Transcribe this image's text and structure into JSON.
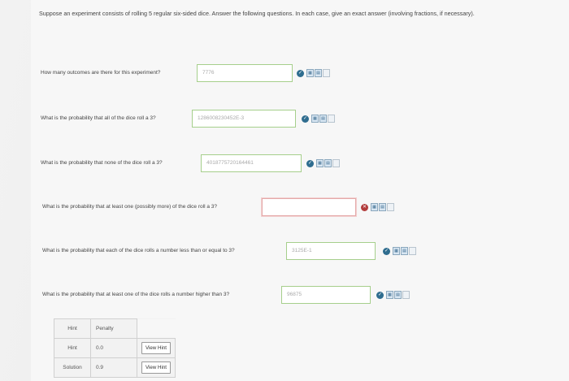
{
  "intro": "Suppose an experiment consists of rolling 5 regular six-sided dice. Answer the following questions. In each case, give an exact answer (involving fractions, if necessary).",
  "questions": [
    {
      "text": "How many outcomes are there for this experiment?",
      "answer": "7776"
    },
    {
      "text": "What is the probability that all of the dice roll a 3?",
      "answer": "1286008230452E-3"
    },
    {
      "text": "What is the probability that none of the dice roll a 3?",
      "answer": "4018775720164461"
    },
    {
      "text": "What is the probability that at least one (possibly more) of the dice roll a 3?",
      "answer": ""
    },
    {
      "text": "What is the probability that each of the dice rolls a number less than or equal to 3?",
      "answer": "3125E-1"
    },
    {
      "text": "What is the probability that at least one of the dice rolls a number higher than 3?",
      "answer": "96875"
    }
  ],
  "hint_table": {
    "headers": [
      "Hint",
      "Penalty"
    ],
    "rows": [
      {
        "label": "Hint",
        "penalty": "0.0",
        "button": "View Hint"
      },
      {
        "label": "Solution",
        "penalty": "0.9",
        "button": "View Hint"
      }
    ]
  },
  "icons": [
    "check-icon",
    "calculator-icon",
    "keypad-icon",
    "notes-icon"
  ]
}
